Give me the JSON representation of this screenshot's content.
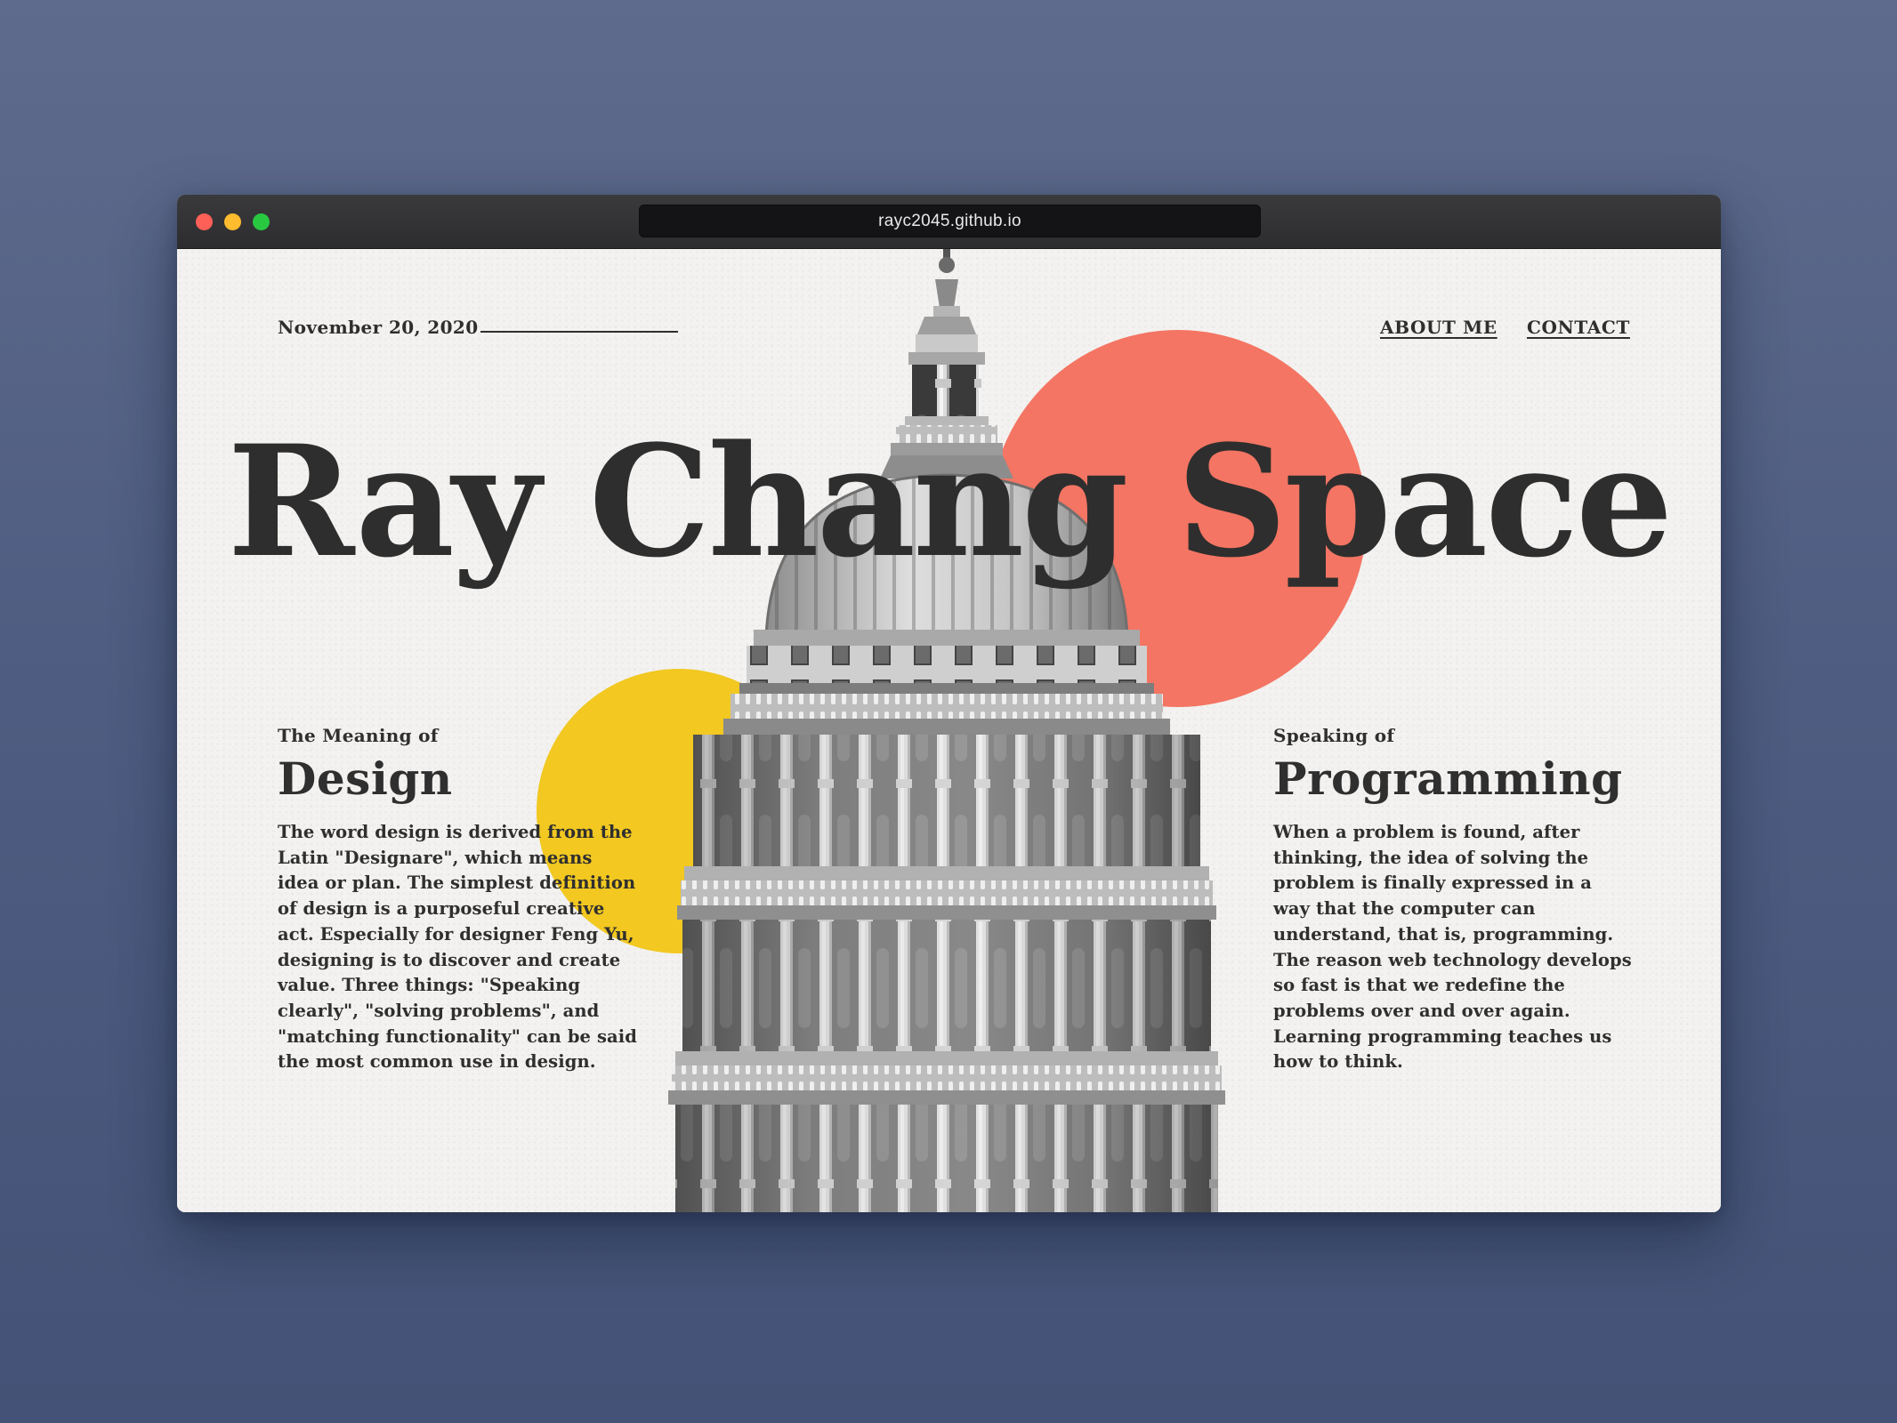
{
  "browser": {
    "url": "rayc2045.github.io"
  },
  "header": {
    "date": "November 20, 2020",
    "nav": [
      {
        "label": "ABOUT ME"
      },
      {
        "label": "CONTACT"
      }
    ]
  },
  "hero": {
    "title": "Ray Chang Space"
  },
  "design_section": {
    "kicker": "The Meaning of",
    "title": "Design",
    "body": "The word design is derived from the Latin \"Designare\", which means idea or plan. The simplest definition of design is a purposeful creative act. Especially for designer Feng Yu, designing is to discover and create value. Three things: \"Speaking clearly\", \"solving problems\", and \"matching functionality\" can be said the most common use in design."
  },
  "programming_section": {
    "kicker": "Speaking of",
    "title": "Programming",
    "body": "When a problem is found, after thinking, the idea of solving the problem is finally expressed in a way that the computer can understand, that is, programming. The reason web technology develops so fast is that we redefine the problems over and over again. Learning programming teaches us how to think."
  },
  "colors": {
    "accent_coral": "#f47563",
    "accent_yellow": "#f2c821",
    "text_dark": "#2e2e2e",
    "paper": "#f3f2f0"
  },
  "images": {
    "hero_image": "domed-cathedral-tower-photo"
  }
}
